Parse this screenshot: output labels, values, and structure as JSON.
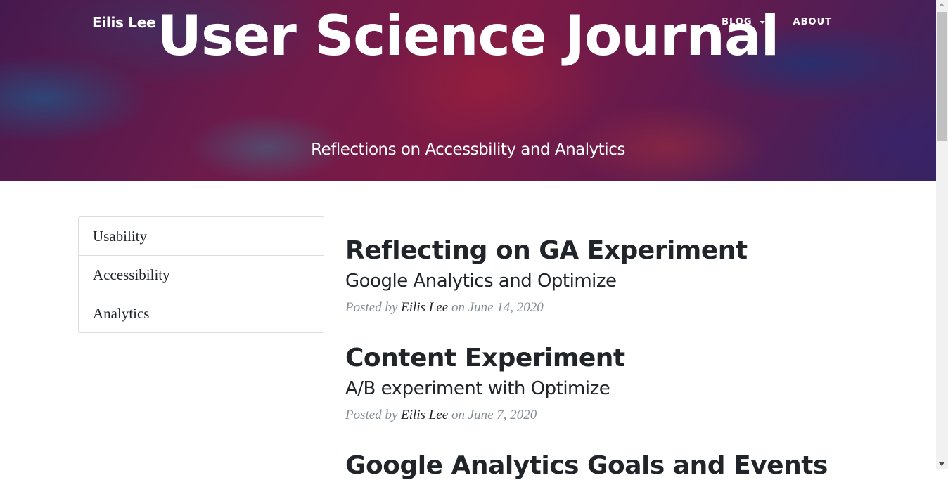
{
  "header": {
    "brand": "Eilis Lee",
    "nav": [
      {
        "label": "BLOG",
        "has_dropdown": true
      },
      {
        "label": "ABOUT",
        "has_dropdown": false
      }
    ],
    "title": "User Science Journal",
    "subtitle": "Reflections on Accessbility and Analytics"
  },
  "sidebar": {
    "items": [
      {
        "label": "Usability"
      },
      {
        "label": "Accessibility"
      },
      {
        "label": "Analytics"
      }
    ]
  },
  "posts": [
    {
      "title": "Reflecting on GA Experiment",
      "subtitle": "Google Analytics and Optimize",
      "meta_prefix": "Posted by",
      "author": "Eilis Lee",
      "meta_on": "on",
      "date": "June 14, 2020"
    },
    {
      "title": "Content Experiment",
      "subtitle": "A/B experiment with Optimize",
      "meta_prefix": "Posted by",
      "author": "Eilis Lee",
      "meta_on": "on",
      "date": "June 7, 2020"
    },
    {
      "title": "Google Analytics Goals and Events"
    }
  ],
  "icons": {
    "dropdown": "caret-down-icon",
    "scroll_up": "scroll-up-arrow-icon",
    "scroll_down": "scroll-down-arrow-icon"
  }
}
